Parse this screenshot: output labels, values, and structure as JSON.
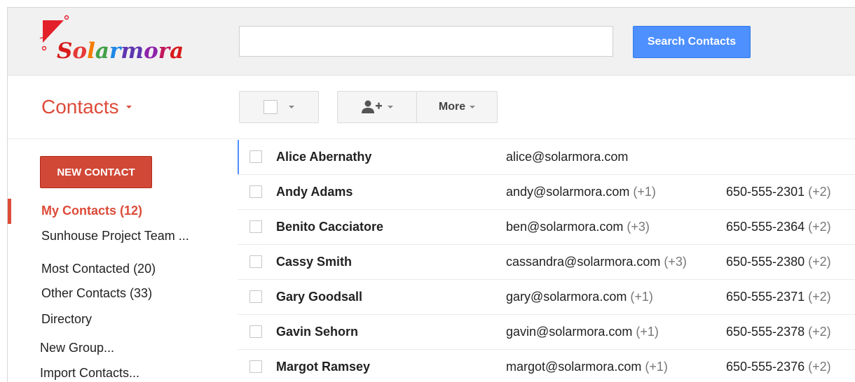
{
  "brand": {
    "logo_text": "Solarmora",
    "logo_colors": [
      "#d81b1b",
      "#e53935",
      "#f57c00",
      "#43a047",
      "#1e88e5",
      "#5e35b1",
      "#8e24aa",
      "#c2185b",
      "#d81b1b"
    ]
  },
  "search": {
    "value": "",
    "placeholder": "",
    "button_label": "Search Contacts"
  },
  "header": {
    "title": "Contacts"
  },
  "toolbar": {
    "more_label": "More"
  },
  "sidebar": {
    "new_contact_label": "NEW CONTACT",
    "items": [
      {
        "label": "My Contacts (12)",
        "active": true
      },
      {
        "label": "Sunhouse Project Team ..."
      },
      {
        "label": "Most Contacted (20)"
      },
      {
        "label": "Other Contacts (33)"
      },
      {
        "label": "Directory"
      },
      {
        "label": "New Group..."
      },
      {
        "label": "Import Contacts..."
      }
    ]
  },
  "contacts": [
    {
      "name": "Alice Abernathy",
      "email": "alice@solarmora.com",
      "email_extra": "",
      "phone": "",
      "phone_extra": ""
    },
    {
      "name": "Andy Adams",
      "email": "andy@solarmora.com",
      "email_extra": "(+1)",
      "phone": "650-555-2301",
      "phone_extra": "(+2)"
    },
    {
      "name": "Benito Cacciatore",
      "email": "ben@solarmora.com",
      "email_extra": "(+3)",
      "phone": "650-555-2364",
      "phone_extra": "(+2)"
    },
    {
      "name": "Cassy Smith",
      "email": "cassandra@solarmora.com",
      "email_extra": "(+3)",
      "phone": "650-555-2380",
      "phone_extra": "(+2)"
    },
    {
      "name": "Gary Goodsall",
      "email": "gary@solarmora.com",
      "email_extra": "(+1)",
      "phone": "650-555-2371",
      "phone_extra": "(+2)"
    },
    {
      "name": "Gavin Sehorn",
      "email": "gavin@solarmora.com",
      "email_extra": "(+1)",
      "phone": "650-555-2378",
      "phone_extra": "(+2)"
    },
    {
      "name": "Margot Ramsey",
      "email": "margot@solarmora.com",
      "email_extra": "(+1)",
      "phone": "650-555-2376",
      "phone_extra": "(+2)"
    }
  ],
  "colors": {
    "accent_red": "#dd4b39",
    "button_blue": "#4d90fe",
    "new_contact_red": "#d14836"
  },
  "icons": {
    "select": "checkbox-icon",
    "add_contact": "add-person-icon",
    "dropdown": "chevron-down-icon"
  }
}
